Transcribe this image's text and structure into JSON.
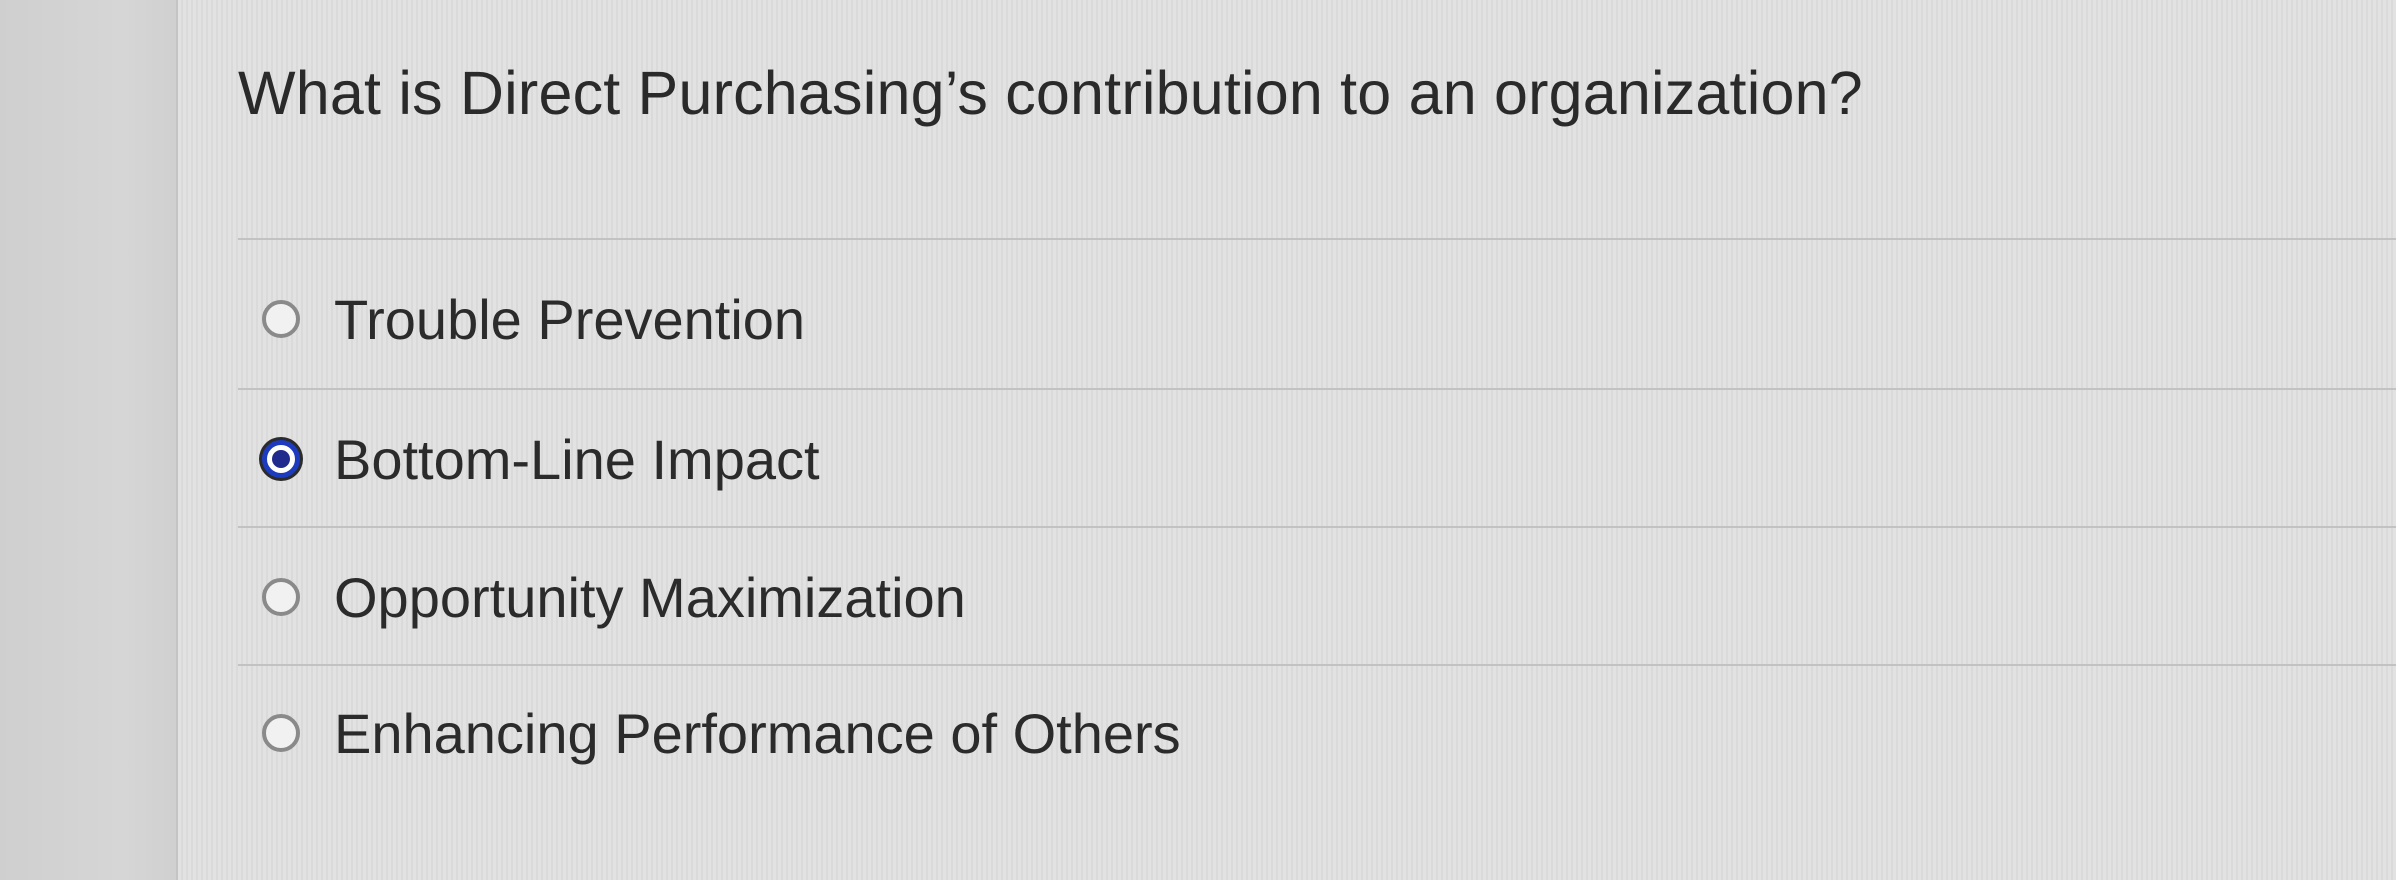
{
  "question": {
    "text": "What is Direct Purchasing’s contribution to an organization?"
  },
  "options": [
    {
      "label": "Trouble Prevention",
      "selected": false
    },
    {
      "label": "Bottom-Line Impact",
      "selected": true
    },
    {
      "label": "Opportunity Maximization",
      "selected": false
    },
    {
      "label": "Enhancing Performance of Others",
      "selected": false
    }
  ],
  "colors": {
    "selected_radio": "#1d3bbf",
    "panel_background": "#e2e2e2",
    "gutter_background": "#d3d3d3"
  }
}
